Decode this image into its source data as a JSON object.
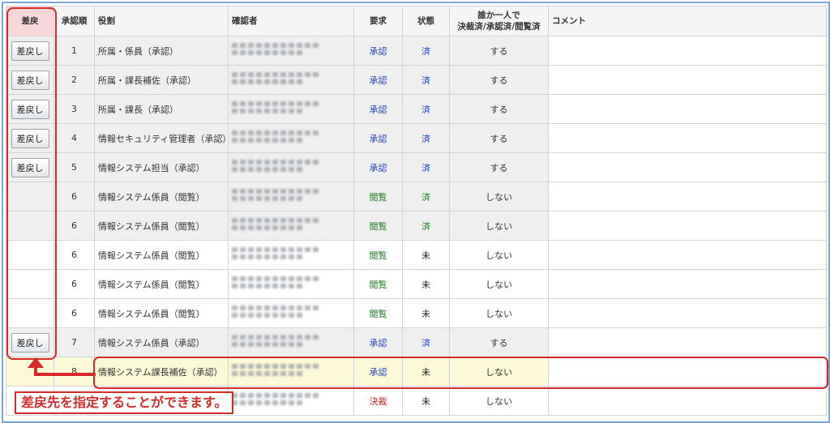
{
  "table": {
    "headers": {
      "sashimodoshi": "差戻",
      "order": "承認順",
      "role": "役割",
      "confirmer": "確認者",
      "request": "要求",
      "status": "状態",
      "anyone_line1": "誰か一人で",
      "anyone_line2": "決裁済/承認済/閲覧済",
      "comment": "コメント"
    },
    "return_button_label": "差戻し",
    "rows": [
      {
        "order": "1",
        "role": "所属・係員（承認）",
        "request": "承認",
        "status": "済",
        "anyone": "する",
        "button": true,
        "shade": "gray"
      },
      {
        "order": "2",
        "role": "所属・課長補佐（承認）",
        "request": "承認",
        "status": "済",
        "anyone": "する",
        "button": true,
        "shade": "gray"
      },
      {
        "order": "3",
        "role": "所属・課長（承認）",
        "request": "承認",
        "status": "済",
        "anyone": "する",
        "button": true,
        "shade": "gray"
      },
      {
        "order": "4",
        "role": "情報セキュリティ管理者（承認）",
        "request": "承認",
        "status": "済",
        "anyone": "する",
        "button": true,
        "shade": "gray"
      },
      {
        "order": "5",
        "role": "情報システム担当（承認）",
        "request": "承認",
        "status": "済",
        "anyone": "する",
        "button": true,
        "shade": "gray"
      },
      {
        "order": "6",
        "role": "情報システム係員（閲覧）",
        "request": "閲覧",
        "status": "済",
        "anyone": "しない",
        "button": false,
        "shade": "gray"
      },
      {
        "order": "6",
        "role": "情報システム係員（閲覧）",
        "request": "閲覧",
        "status": "済",
        "anyone": "しない",
        "button": false,
        "shade": "gray"
      },
      {
        "order": "6",
        "role": "情報システム係員（閲覧）",
        "request": "閲覧",
        "status": "未",
        "anyone": "しない",
        "button": false,
        "shade": "white"
      },
      {
        "order": "6",
        "role": "情報システム係員（閲覧）",
        "request": "閲覧",
        "status": "未",
        "anyone": "しない",
        "button": false,
        "shade": "white"
      },
      {
        "order": "6",
        "role": "情報システム係員（閲覧）",
        "request": "閲覧",
        "status": "未",
        "anyone": "しない",
        "button": false,
        "shade": "white"
      },
      {
        "order": "7",
        "role": "情報システム係員（承認）",
        "request": "承認",
        "status": "済",
        "anyone": "する",
        "button": true,
        "shade": "gray"
      },
      {
        "order": "8",
        "role": "情報システム課長補佐（承認）",
        "request": "承認",
        "status": "未",
        "anyone": "しない",
        "button": false,
        "shade": "yellow"
      },
      {
        "order": "",
        "role": "",
        "request": "決裁",
        "status": "未",
        "anyone": "しない",
        "button": false,
        "shade": "white"
      }
    ]
  },
  "annotation": {
    "callout_text": "差戻先を指定することができます。"
  },
  "colors": {
    "highlight_red": "#d42a2a",
    "request_approve": "#1f3fbf",
    "request_view": "#1e7b1e",
    "request_decide": "#cc1e1e",
    "current_row": "#fcf9d6",
    "frame_border": "#7aa5d6"
  }
}
